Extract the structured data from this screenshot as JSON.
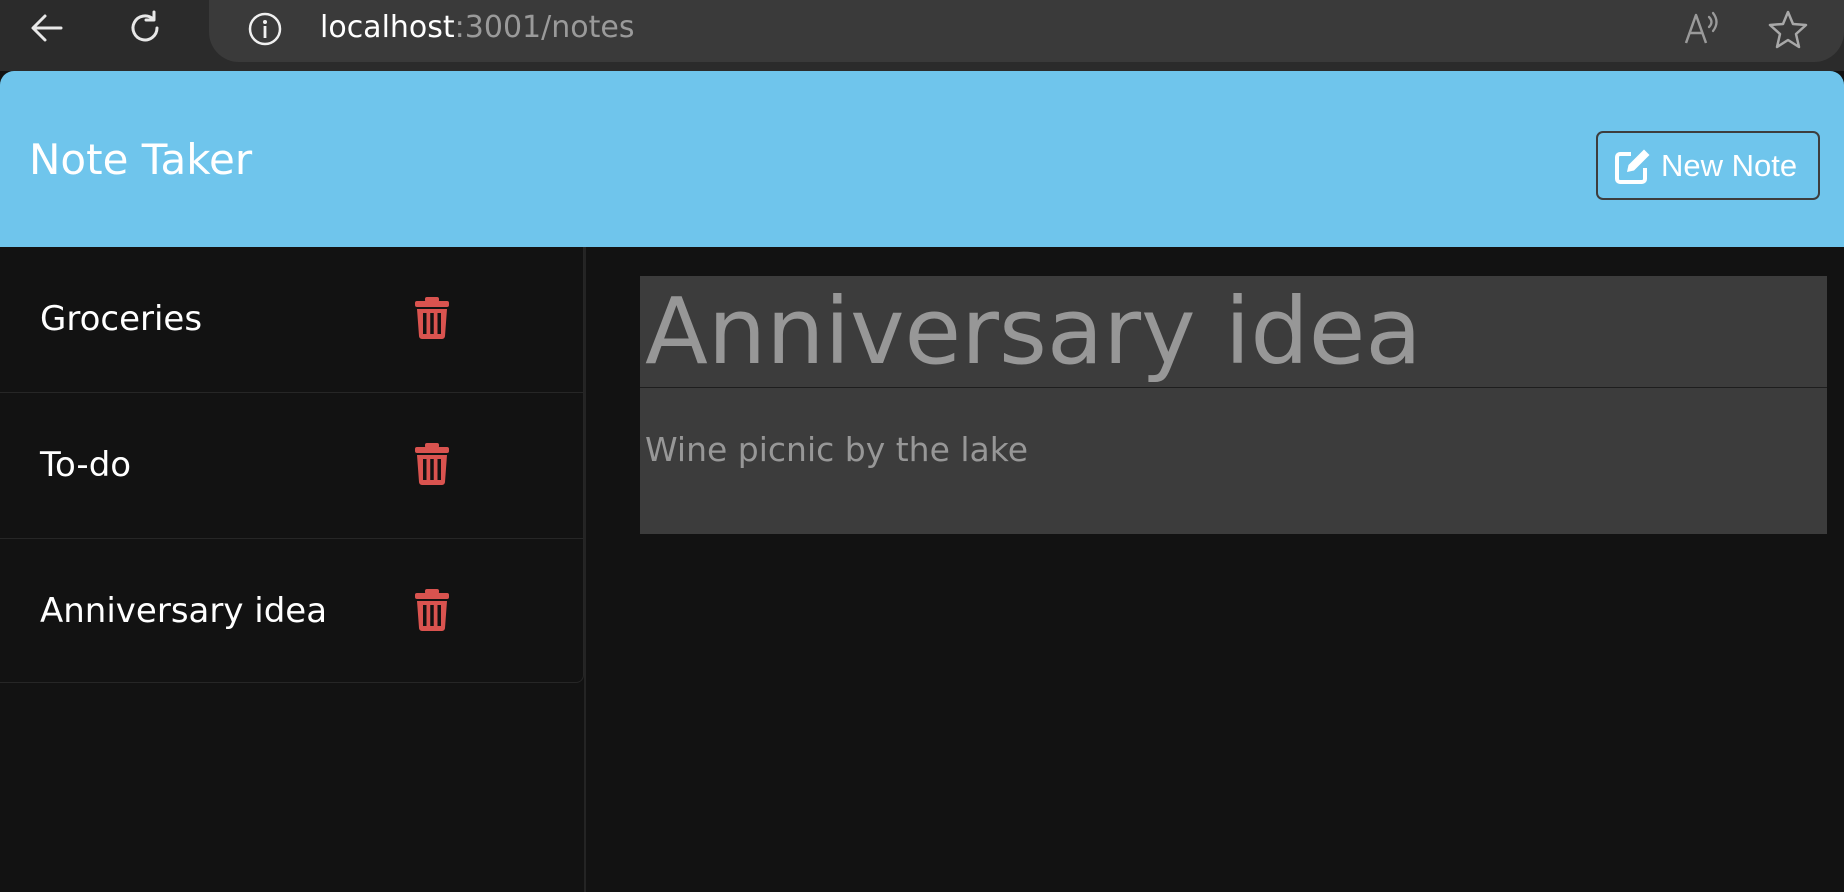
{
  "browser": {
    "url_host": "localhost",
    "url_path": ":3001/notes",
    "icons": {
      "back": "back-arrow-icon",
      "reload": "reload-icon",
      "info": "info-icon",
      "read_aloud": "read-aloud-icon",
      "favorite": "star-icon"
    }
  },
  "navbar": {
    "title": "Note Taker",
    "new_note_label": "New Note",
    "new_note_icon": "edit-icon",
    "background_color": "#6fc5ec"
  },
  "sidebar": {
    "delete_icon": "trash-icon",
    "delete_color": "#d9534f",
    "notes": [
      {
        "title": "Groceries"
      },
      {
        "title": "To-do"
      },
      {
        "title": "Anniversary idea"
      }
    ]
  },
  "editor": {
    "title_value": "Anniversary idea",
    "text_value": "Wine picnic by the lake"
  }
}
